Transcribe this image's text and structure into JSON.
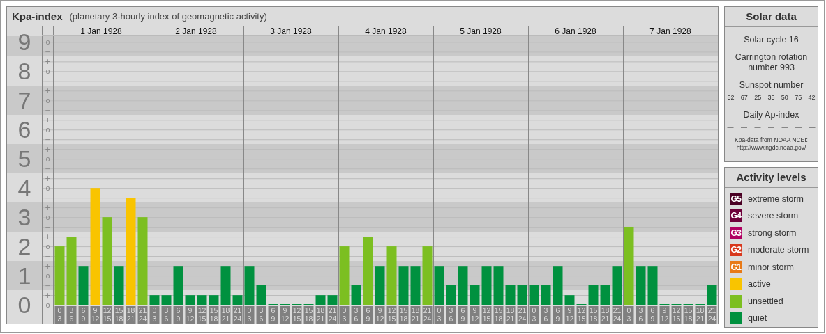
{
  "kp_panel": {
    "title": "Kpa-index",
    "subtitle": "(planetary 3-hourly index of geomagnetic activity)",
    "day_labels": [
      "1 Jan 1928",
      "2 Jan 1928",
      "3 Jan 1928",
      "4 Jan 1928",
      "5 Jan 1928",
      "6 Jan 1928",
      "7 Jan 1928"
    ],
    "sublevel_labels": [
      "o",
      "−",
      "+",
      "o",
      "−",
      "+",
      "o",
      "−",
      "+",
      "o",
      "−",
      "+",
      "o",
      "−",
      "+",
      "o",
      "−",
      "+",
      "o",
      "−",
      "+",
      "o",
      "−",
      "+",
      "o",
      "−",
      "+",
      "o"
    ],
    "chart_data": {
      "type": "bar",
      "stacked": true,
      "grid": true,
      "ylim": [
        0,
        9.2
      ],
      "yticks": [
        0,
        1,
        2,
        3,
        4,
        5,
        6,
        7,
        8,
        9
      ],
      "categories": [
        "0 3",
        "3 6",
        "6 9",
        "9 12",
        "12 15",
        "15 18",
        "18 21",
        "21 24",
        "0 3",
        "3 6",
        "6 9",
        "9 12",
        "12 15",
        "15 18",
        "18 21",
        "21 24",
        "0 3",
        "3 6",
        "6 9",
        "9 12",
        "12 15",
        "15 18",
        "18 21",
        "21 24",
        "0 3",
        "3 6",
        "6 9",
        "9 12",
        "12 15",
        "15 18",
        "18 21",
        "21 24",
        "0 3",
        "3 6",
        "6 9",
        "9 12",
        "12 15",
        "15 18",
        "18 21",
        "21 24",
        "0 3",
        "3 6",
        "6 9",
        "9 12",
        "12 15",
        "15 18",
        "18 21",
        "21 24",
        "0 3",
        "3 6",
        "6 9",
        "9 12",
        "12 15",
        "15 18",
        "18 21",
        "21 24"
      ],
      "series": [
        {
          "color": "#00913f",
          "values": [
            null,
            null,
            1.33,
            null,
            null,
            1.33,
            null,
            null,
            0.33,
            0.33,
            1.33,
            0.33,
            0.33,
            0.33,
            1.33,
            0.33,
            1.33,
            0.67,
            0,
            0,
            0,
            0,
            0.33,
            0.33,
            null,
            0.67,
            null,
            1.33,
            null,
            1.33,
            1.33,
            null,
            1.33,
            0.67,
            1.33,
            0.67,
            1.33,
            1.33,
            0.67,
            0.67,
            0.67,
            0.67,
            1.33,
            0.33,
            0,
            0.67,
            0.67,
            1.33,
            null,
            1.33,
            1.33,
            0,
            0,
            0,
            0,
            0.67
          ]
        },
        {
          "color": "#7cbf21",
          "values": [
            2,
            2.33,
            null,
            null,
            3,
            null,
            null,
            3,
            null,
            null,
            null,
            null,
            null,
            null,
            null,
            null,
            null,
            null,
            null,
            null,
            null,
            null,
            null,
            null,
            2,
            null,
            2.33,
            null,
            2,
            null,
            null,
            2,
            null,
            null,
            null,
            null,
            null,
            null,
            null,
            null,
            null,
            null,
            null,
            null,
            null,
            null,
            null,
            null,
            2.67,
            null,
            null,
            null,
            null,
            null,
            null,
            null
          ]
        },
        {
          "color": "#f9c400",
          "values": [
            null,
            null,
            null,
            4,
            null,
            null,
            3.67,
            null,
            null,
            null,
            null,
            null,
            null,
            null,
            null,
            null,
            null,
            null,
            null,
            null,
            null,
            null,
            null,
            null,
            null,
            null,
            null,
            null,
            null,
            null,
            null,
            null,
            null,
            null,
            null,
            null,
            null,
            null,
            null,
            null,
            null,
            null,
            null,
            null,
            null,
            null,
            null,
            null,
            null,
            null,
            null,
            null,
            null,
            null,
            null,
            null
          ]
        }
      ]
    }
  },
  "solar_data": {
    "title": "Solar data",
    "solar_cycle": "Solar cycle 16",
    "carrington_rotation": "Carrington rotation number 993",
    "sunspot_label": "Sunspot number",
    "sunspot_values": [
      "52",
      "67",
      "25",
      "35",
      "50",
      "75",
      "42"
    ],
    "ap_label": "Daily Ap-index",
    "ap_values": [
      "—",
      "—",
      "—",
      "—",
      "—",
      "—",
      "—"
    ],
    "source_note": "Kpa-data from NOAA NCEI:",
    "source_url": "http://www.ngdc.noaa.gov/"
  },
  "activity_levels": {
    "title": "Activity levels",
    "levels": [
      {
        "badge": "G5",
        "label": "extreme storm",
        "color": "#4a0024"
      },
      {
        "badge": "G4",
        "label": "severe storm",
        "color": "#6e003a"
      },
      {
        "badge": "G3",
        "label": "strong storm",
        "color": "#b00062"
      },
      {
        "badge": "G2",
        "label": "moderate storm",
        "color": "#d8381d"
      },
      {
        "badge": "G1",
        "label": "minor storm",
        "color": "#e87a18"
      },
      {
        "label": "active",
        "color": "#f9c400"
      },
      {
        "label": "unsettled",
        "color": "#7cbf21"
      },
      {
        "label": "quiet",
        "color": "#00913f"
      }
    ]
  }
}
